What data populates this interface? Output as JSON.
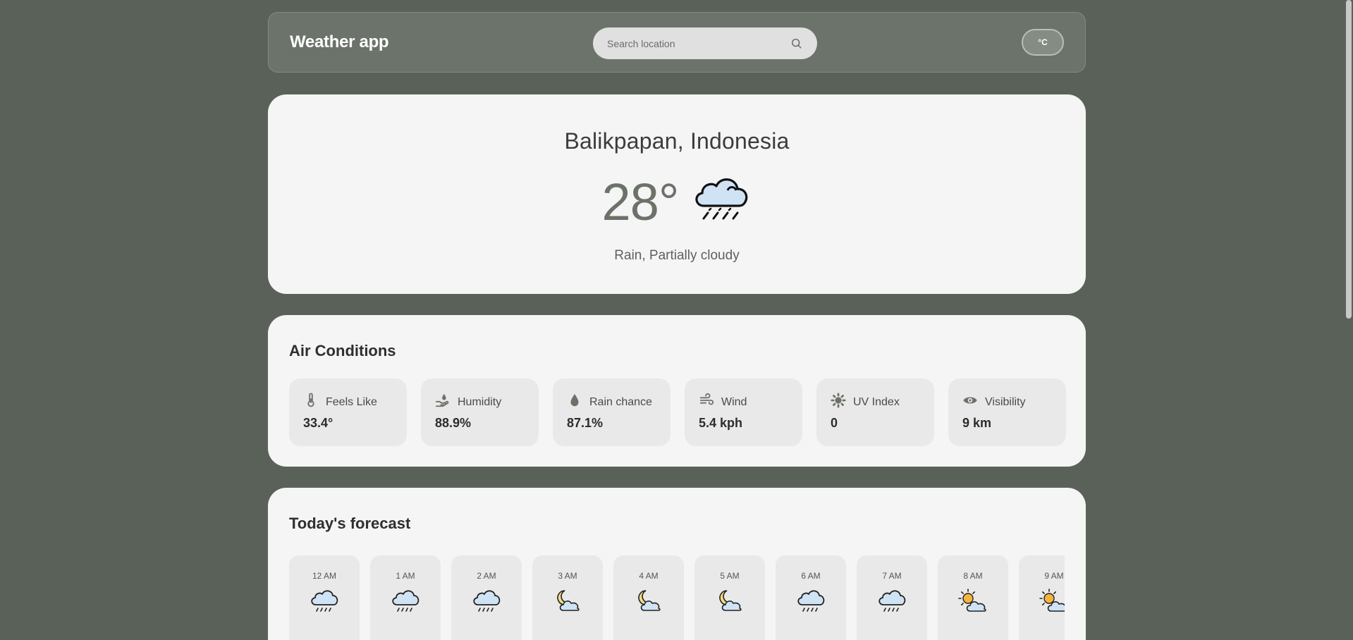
{
  "header": {
    "title": "Weather app",
    "search_placeholder": "Search location",
    "unit_label": "°C"
  },
  "current": {
    "location": "Balikpapan, Indonesia",
    "temperature": "28°",
    "condition": "Rain, Partially cloudy",
    "icon": "rain-cloud-icon"
  },
  "air_conditions": {
    "title": "Air Conditions",
    "items": [
      {
        "label": "Feels Like",
        "value": "33.4°",
        "icon": "thermometer-icon"
      },
      {
        "label": "Humidity",
        "value": "88.9%",
        "icon": "hand-drop-icon"
      },
      {
        "label": "Rain chance",
        "value": "87.1%",
        "icon": "drop-icon"
      },
      {
        "label": "Wind",
        "value": "5.4 kph",
        "icon": "wind-icon"
      },
      {
        "label": "UV Index",
        "value": "0",
        "icon": "sun-gear-icon"
      },
      {
        "label": "Visibility",
        "value": "9 km",
        "icon": "eye-icon"
      }
    ]
  },
  "forecast": {
    "title": "Today's forecast",
    "hours": [
      {
        "time": "12 AM",
        "icon": "rain-cloud-icon"
      },
      {
        "time": "1 AM",
        "icon": "rain-cloud-icon"
      },
      {
        "time": "2 AM",
        "icon": "rain-cloud-icon"
      },
      {
        "time": "3 AM",
        "icon": "moon-cloud-icon"
      },
      {
        "time": "4 AM",
        "icon": "moon-cloud-icon"
      },
      {
        "time": "5 AM",
        "icon": "moon-cloud-icon"
      },
      {
        "time": "6 AM",
        "icon": "rain-cloud-icon"
      },
      {
        "time": "7 AM",
        "icon": "rain-cloud-icon"
      },
      {
        "time": "8 AM",
        "icon": "sun-cloud-icon"
      },
      {
        "time": "9 AM",
        "icon": "sun-cloud-icon"
      }
    ]
  },
  "colors": {
    "background": "#5a6159",
    "card": "#f5f5f5",
    "accent": "#6b7268",
    "icon_cloud": "#cfe3f5",
    "icon_sun": "#f5b53c",
    "icon_moon": "#f3dc85"
  }
}
